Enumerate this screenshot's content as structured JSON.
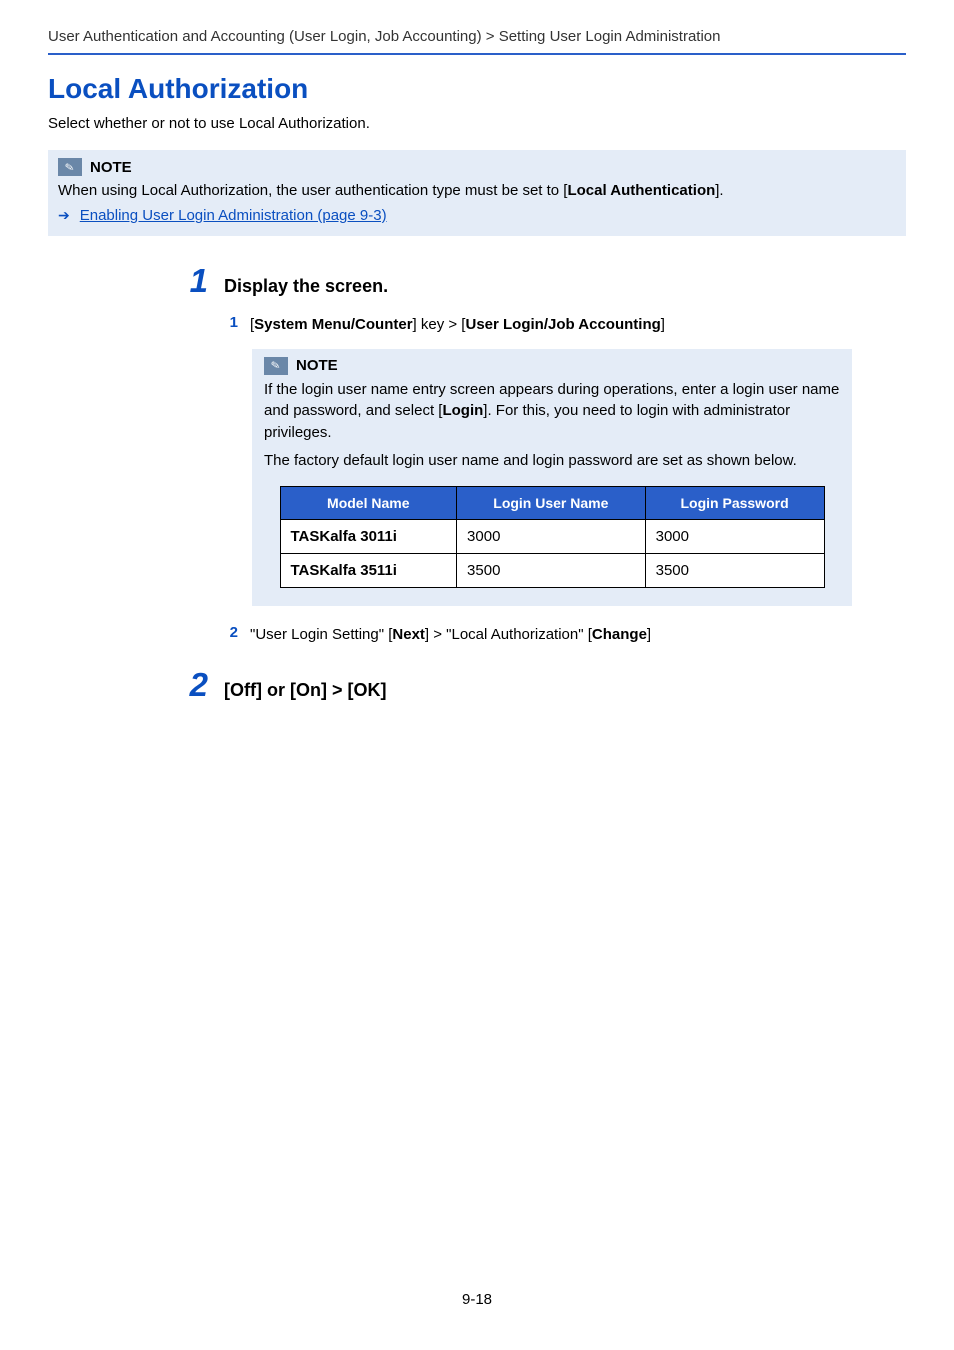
{
  "breadcrumb": "User Authentication and Accounting (User Login, Job Accounting) > Setting User Login Administration",
  "title": "Local Authorization",
  "intro": "Select whether or not to use Local Authorization.",
  "note1": {
    "label": "NOTE",
    "text_pre": "When using Local Authorization, the user authentication type must be set to [",
    "text_bold": "Local Authentication",
    "text_post": "].",
    "link": "Enabling User Login Administration (page 9-3)"
  },
  "step1": {
    "num": "1",
    "title": "Display the screen.",
    "sub1": {
      "num": "1",
      "pre": "[",
      "b1": "System Menu/Counter",
      "mid1": "] key > [",
      "b2": "User Login/Job Accounting",
      "post": "]"
    },
    "innerNote": {
      "label": "NOTE",
      "p1_a": "If the login user name entry screen appears during operations, enter a login user name and password, and select [",
      "p1_b": "Login",
      "p1_c": "]. For this, you need to login with administrator privileges.",
      "p2": "The factory default login user name and login password are set as shown below."
    },
    "table": {
      "h1": "Model Name",
      "h2": "Login User Name",
      "h3": "Login Password",
      "rows": [
        {
          "model": "TASKalfa 3011i",
          "user": "3000",
          "pass": "3000"
        },
        {
          "model": "TASKalfa 3511i",
          "user": "3500",
          "pass": "3500"
        }
      ]
    },
    "sub2": {
      "num": "2",
      "a": "\"User Login Setting\" [",
      "b1": "Next",
      "b": "] > \"Local Authorization\" [",
      "b2": "Change",
      "c": "]"
    }
  },
  "step2": {
    "num": "2",
    "title": "[Off] or [On] > [OK]"
  },
  "pageNum": "9-18"
}
